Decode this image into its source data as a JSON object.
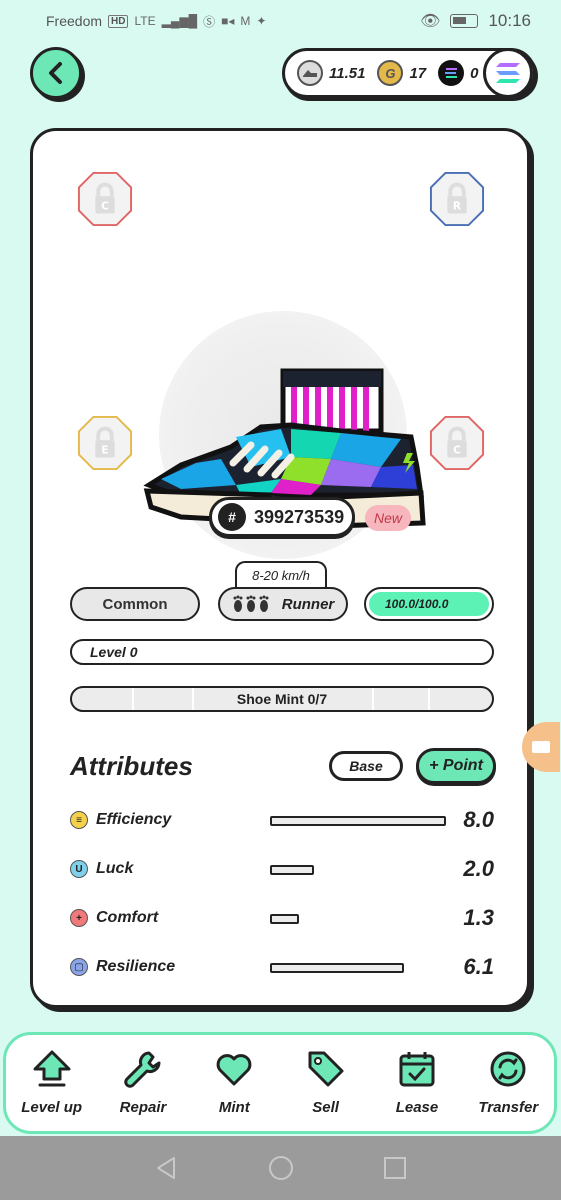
{
  "status_bar": {
    "carrier": "Freedom",
    "network": "HD",
    "lte": "LTE",
    "time": "10:16"
  },
  "header": {
    "balances": [
      {
        "icon": "gst-icon",
        "value": "11.51"
      },
      {
        "icon": "gmt-icon",
        "value": "17"
      },
      {
        "icon": "sol-icon",
        "value": "0"
      }
    ]
  },
  "shoe": {
    "sockets": [
      {
        "position": "top-left",
        "letter": "C",
        "color": "#e06666"
      },
      {
        "position": "top-right",
        "letter": "R",
        "color": "#4a6fb5"
      },
      {
        "position": "bottom-left",
        "letter": "E",
        "color": "#e3b94a"
      },
      {
        "position": "bottom-right",
        "letter": "C",
        "color": "#e06666"
      }
    ],
    "id_hash": "#",
    "id": "399273539",
    "badge": "New",
    "speed_range": "8-20 km/h",
    "quality": "Common",
    "type": "Runner",
    "durability": "100.0/100.0",
    "durability_fraction": 1.0,
    "level": "Level 0",
    "shoe_mint": "Shoe Mint 0/7"
  },
  "attributes": {
    "title": "Attributes",
    "base_label": "Base",
    "point_label": "+ Point",
    "items": [
      {
        "name": "Efficiency",
        "value": "8.0",
        "icon": "efficiency-icon",
        "icon_glyph": "≡",
        "color": "#f5d04a"
      },
      {
        "name": "Luck",
        "value": "2.0",
        "icon": "luck-icon",
        "icon_glyph": "U",
        "color": "#7fd0ea"
      },
      {
        "name": "Comfort",
        "value": "1.3",
        "icon": "comfort-icon",
        "icon_glyph": "+",
        "color": "#f07a7a"
      },
      {
        "name": "Resilience",
        "value": "6.1",
        "icon": "resilience-icon",
        "icon_glyph": "▢",
        "color": "#8aa4e8"
      }
    ]
  },
  "actions": [
    {
      "label": "Level up",
      "icon": "level-up-icon"
    },
    {
      "label": "Repair",
      "icon": "wrench-icon"
    },
    {
      "label": "Mint",
      "icon": "heart-icon"
    },
    {
      "label": "Sell",
      "icon": "tag-icon"
    },
    {
      "label": "Lease",
      "icon": "calendar-icon"
    },
    {
      "label": "Transfer",
      "icon": "transfer-icon"
    }
  ],
  "colors": {
    "accent": "#6ee7b7",
    "background": "#d9faf0",
    "durability_fill": "#5cf2b6"
  }
}
